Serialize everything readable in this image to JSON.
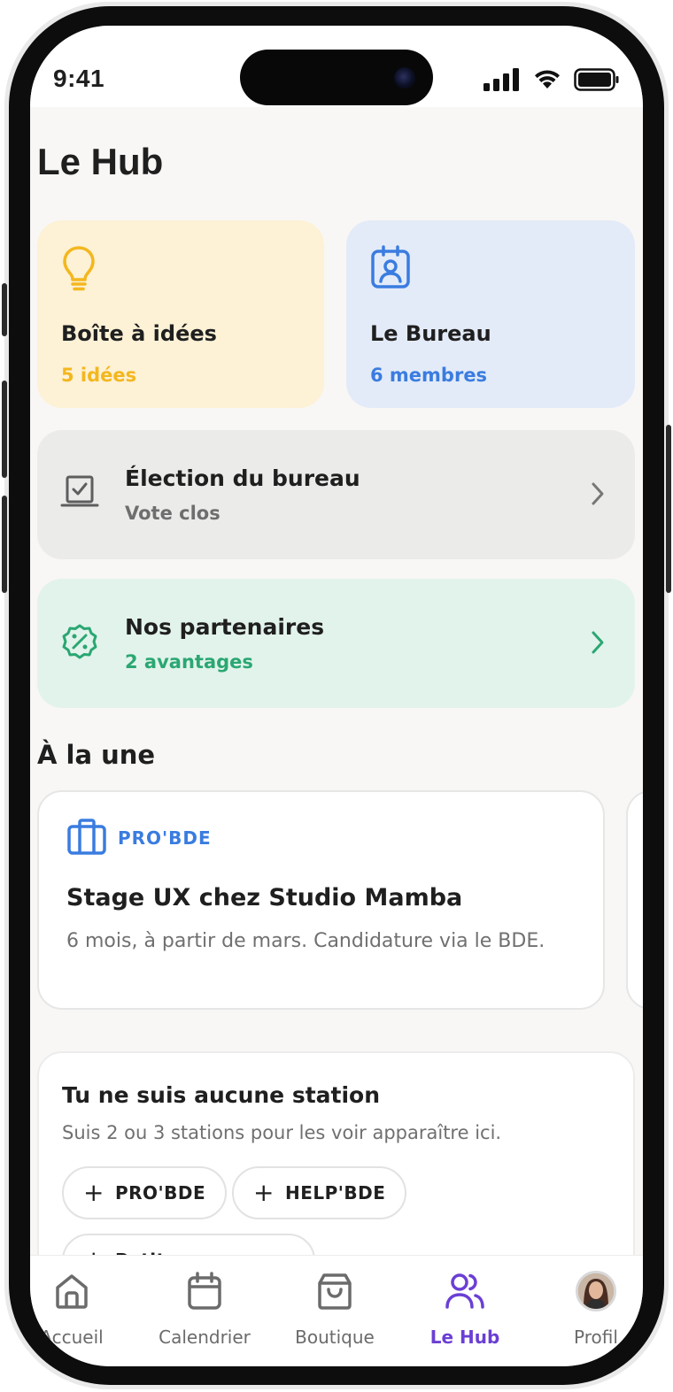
{
  "status_bar": {
    "time": "9:41"
  },
  "page": {
    "title": "Le Hub"
  },
  "tiles": {
    "ideas": {
      "title": "Boîte à idées",
      "subtitle": "5 idées",
      "icon": "lightbulb-icon"
    },
    "bureau": {
      "title": "Le Bureau",
      "subtitle": "6 membres",
      "icon": "id-badge-icon"
    }
  },
  "rows": {
    "election": {
      "title": "Élection du bureau",
      "subtitle": "Vote clos",
      "icon": "ballot-box-icon"
    },
    "partners": {
      "title": "Nos partenaires",
      "subtitle": "2 avantages",
      "icon": "discount-badge-icon"
    }
  },
  "une": {
    "section_title": "À la une",
    "cards": [
      {
        "category": "PRO'BDE",
        "title": "Stage UX chez Studio Mamba",
        "description": "6 mois, à partir de mars. Candidature via le BDE."
      }
    ]
  },
  "stations": {
    "title": "Tu ne suis aucune station",
    "subtitle": "Suis 2 ou 3 stations pour les voir apparaître ici.",
    "chips": [
      "PRO'BDE",
      "HELP'BDE",
      "Petites annonces"
    ]
  },
  "tabbar": {
    "tabs": [
      {
        "label": "Accueil",
        "icon": "home-icon"
      },
      {
        "label": "Calendrier",
        "icon": "calendar-icon"
      },
      {
        "label": "Boutique",
        "icon": "shopping-bag-icon"
      },
      {
        "label": "Le Hub",
        "icon": "users-icon",
        "active": true
      },
      {
        "label": "Profil",
        "icon": "avatar"
      }
    ]
  },
  "colors": {
    "accent": "#6b3fd4",
    "ideas_yellow": "#f3b71e",
    "bureau_blue": "#3a7ce0",
    "partners_green": "#2aa772"
  }
}
